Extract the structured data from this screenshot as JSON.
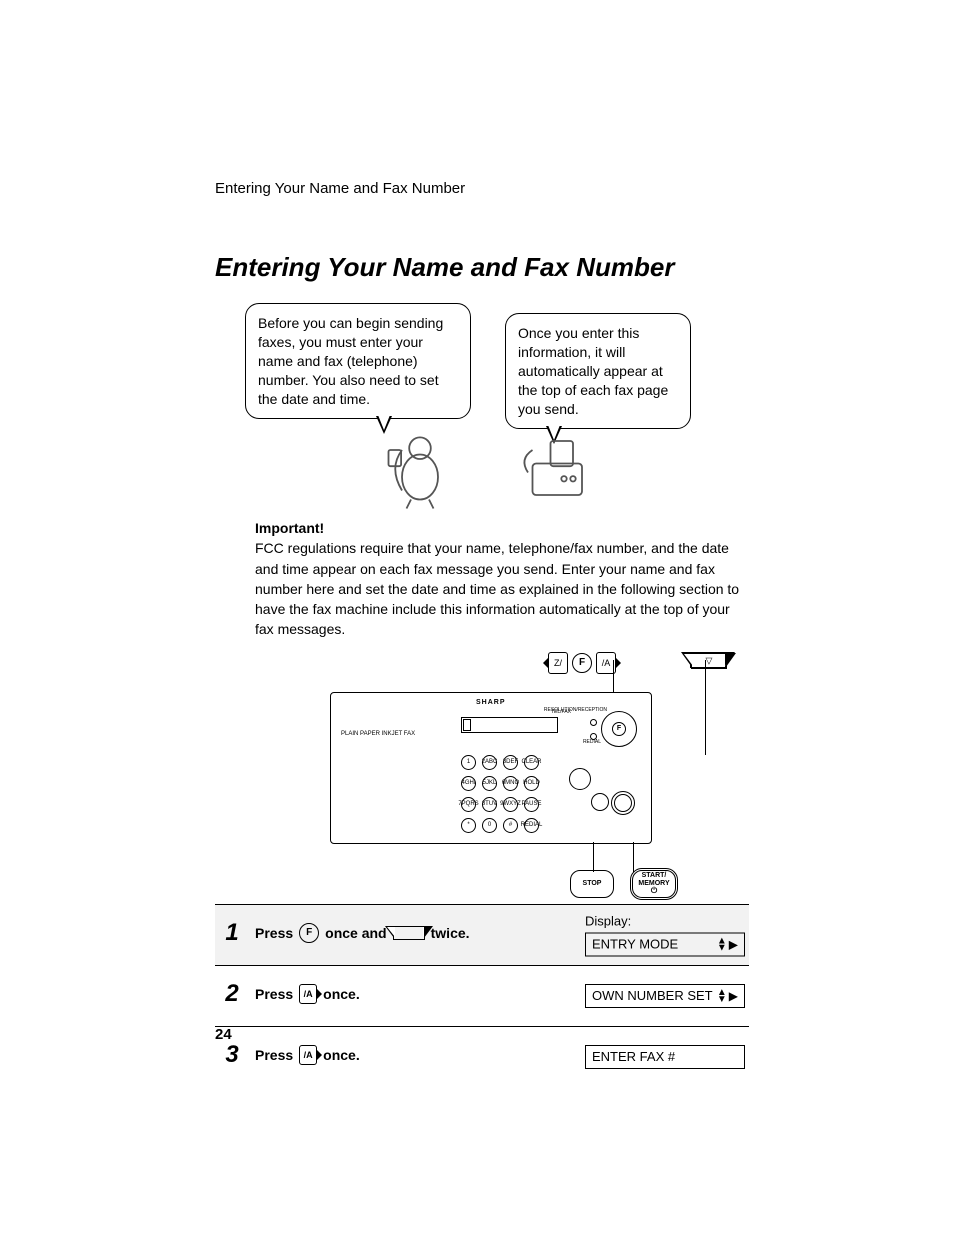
{
  "running_head": "Entering Your Name and Fax Number",
  "title": "Entering Your Name and Fax Number",
  "bubble_left": "Before you can begin sending faxes, you must enter your name and fax (telephone) number. You also need to set the date and time.",
  "bubble_right": "Once you enter this information, it will automatically appear at the top of each fax page you send.",
  "important_heading": "Important!",
  "important_body": "FCC regulations require that your name, telephone/fax number, and the date and time appear on each fax message you send. Enter your name and fax number here and set the date and time as explained in the following section to have the fax machine include this information automatically at the top of your fax messages.",
  "panel": {
    "brand": "SHARP",
    "model": "PLAIN PAPER INKJET FAX",
    "tiny_labels": {
      "t1": "TEL/FAX",
      "t2": "RESOLUTION/RECEPTION",
      "t3": "REDIAL"
    },
    "f_label": "F",
    "keys_row1": [
      "1",
      "2ABC",
      "3DEF",
      "CLEAR"
    ],
    "keys_row2": [
      "4GHI",
      "5JKL",
      "6MNO",
      "HOLD"
    ],
    "keys_row3": [
      "7PQRS",
      "8TUV",
      "9WXYZ",
      "PAUSE"
    ],
    "keys_row4": [
      "*",
      "0",
      "#",
      "REDIAL"
    ],
    "stop_label": "STOP",
    "start_label_line1": "START/",
    "start_label_line2": "MEMORY"
  },
  "callout_arrow_left_label": "Z/",
  "callout_arrow_right_label": "/A",
  "steps": [
    {
      "num": "1",
      "press": "Press",
      "once_and": "once and",
      "twice": "twice.",
      "display_label": "Display:",
      "display_text": "ENTRY MODE",
      "display_arrows": "updown_right"
    },
    {
      "num": "2",
      "press": "Press",
      "once": "once.",
      "display_text": "OWN NUMBER SET",
      "display_arrows": "updown_right"
    },
    {
      "num": "3",
      "press": "Press",
      "once": "once.",
      "display_text": "ENTER FAX #",
      "display_arrows": "none"
    }
  ],
  "page_number": "24"
}
